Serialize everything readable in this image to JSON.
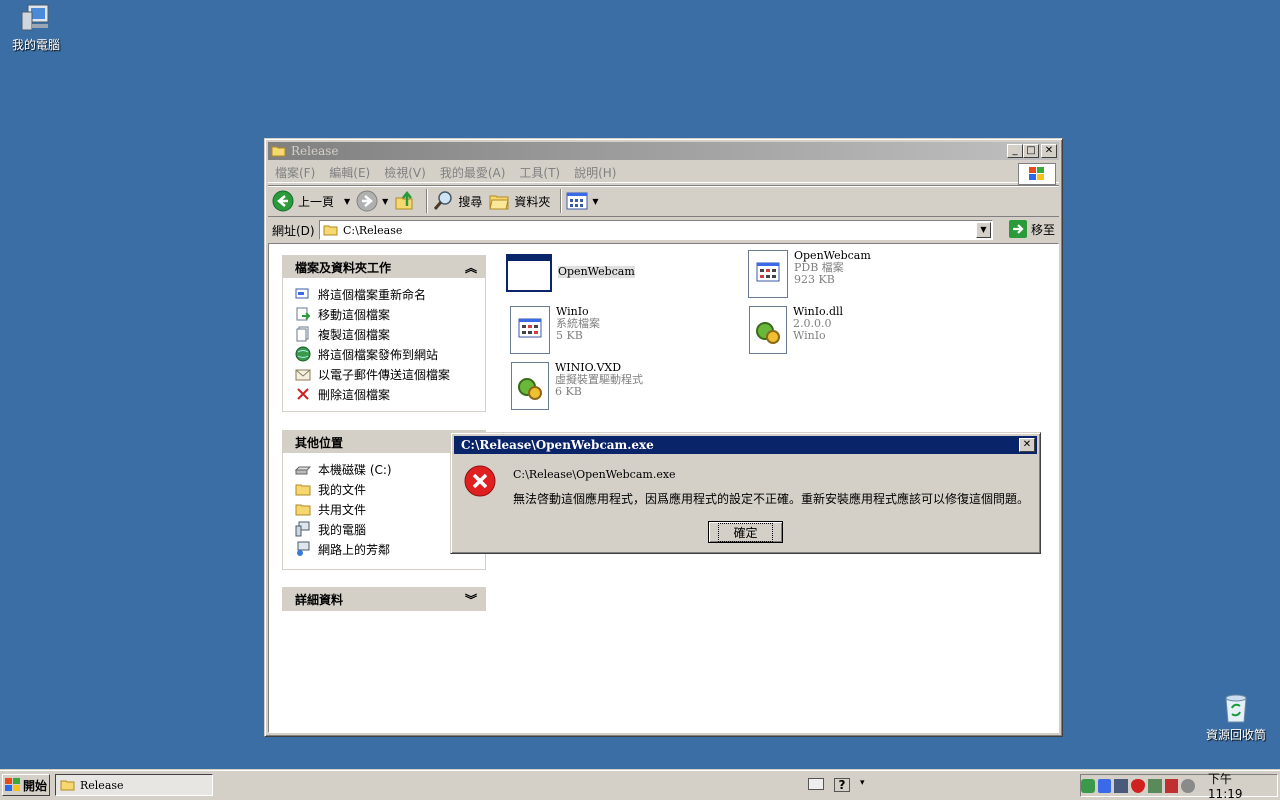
{
  "desktop": {
    "my_computer": "我的電腦",
    "recycle_bin": "資源回收筒"
  },
  "explorer": {
    "title": "Release",
    "menu": [
      "檔案(F)",
      "編輯(E)",
      "檢視(V)",
      "我的最愛(A)",
      "工具(T)",
      "說明(H)"
    ],
    "toolbar": {
      "back": "上一頁",
      "search": "搜尋",
      "folders": "資料夾"
    },
    "address": {
      "label": "網址(D)",
      "value": "C:\\Release",
      "go": "移至"
    },
    "panels": {
      "tasks": {
        "title": "檔案及資料夾工作",
        "items": [
          "將這個檔案重新命名",
          "移動這個檔案",
          "複製這個檔案",
          "將這個檔案發佈到網站",
          "以電子郵件傳送這個檔案",
          "刪除這個檔案"
        ]
      },
      "places": {
        "title": "其他位置",
        "items": [
          "本機磁碟 (C:)",
          "我的文件",
          "共用文件",
          "我的電腦",
          "網路上的芳鄰"
        ]
      },
      "details": {
        "title": "詳細資料"
      }
    },
    "files": [
      {
        "name": "OpenWebcam",
        "line2": "",
        "line3": ""
      },
      {
        "name": "OpenWebcam",
        "line2": "PDB 檔案",
        "line3": "923 KB"
      },
      {
        "name": "WinIo",
        "line2": "系統檔案",
        "line3": "5 KB"
      },
      {
        "name": "WinIo.dll",
        "line2": "2.0.0.0",
        "line3": "WinIo"
      },
      {
        "name": "WINIO.VXD",
        "line2": "虛擬裝置驅動程式",
        "line3": "6 KB"
      }
    ]
  },
  "dialog": {
    "title": "C:\\Release\\OpenWebcam.exe",
    "path": "C:\\Release\\OpenWebcam.exe",
    "message": "無法啓動這個應用程式，因爲應用程式的設定不正確。重新安裝應用程式應該可以修復這個問題。",
    "ok": "確定"
  },
  "taskbar": {
    "start": "開始",
    "task": "Release",
    "clock": "下午 11:19"
  }
}
